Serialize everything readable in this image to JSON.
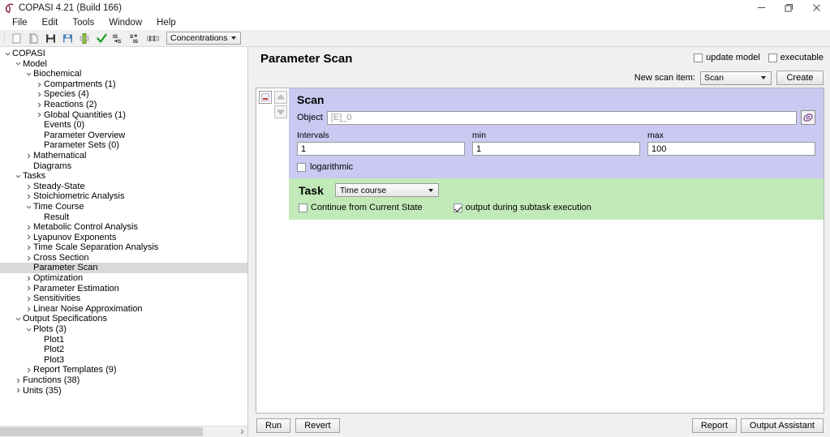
{
  "window": {
    "title": "COPASI 4.21 (Build 166)",
    "logo_icon": "copasi-logo-icon",
    "controls": [
      {
        "name": "minimize-button",
        "icon": "minimize-icon"
      },
      {
        "name": "restore-button",
        "icon": "restore-icon"
      },
      {
        "name": "close-button",
        "icon": "close-icon"
      }
    ]
  },
  "menubar": {
    "items": [
      {
        "label": "File"
      },
      {
        "label": "Edit"
      },
      {
        "label": "Tools"
      },
      {
        "label": "Window"
      },
      {
        "label": "Help"
      }
    ]
  },
  "toolbar": {
    "buttons": [
      {
        "name": "new-button",
        "icon": "new-document-icon"
      },
      {
        "name": "open-button",
        "icon": "open-folder-icon"
      },
      {
        "name": "save-button",
        "icon": "floppy-disk-icon"
      },
      {
        "name": "save-as-button",
        "icon": "save-as-icon"
      },
      {
        "name": "import-sbml-button",
        "icon": "import-icon"
      },
      {
        "name": "check-model-button",
        "icon": "check-mark-icon"
      },
      {
        "name": "sbml-to-copasi-button",
        "icon": "sbml-to-s-icon"
      },
      {
        "name": "copasi-to-sbml-button",
        "icon": "s-to-sbml-icon"
      },
      {
        "name": "sliders-button",
        "icon": "slider-icon"
      }
    ],
    "units_combo": {
      "value": "Concentrations",
      "icon": "chevron-down-icon"
    }
  },
  "sidebar": {
    "tree": [
      {
        "label": "COPASI",
        "indent": 0,
        "twist": "expanded",
        "selected": false
      },
      {
        "label": "Model",
        "indent": 1,
        "twist": "expanded",
        "selected": false
      },
      {
        "label": "Biochemical",
        "indent": 2,
        "twist": "expanded",
        "selected": false
      },
      {
        "label": "Compartments (1)",
        "indent": 3,
        "twist": "collapsed",
        "selected": false
      },
      {
        "label": "Species (4)",
        "indent": 3,
        "twist": "collapsed",
        "selected": false
      },
      {
        "label": "Reactions (2)",
        "indent": 3,
        "twist": "collapsed",
        "selected": false
      },
      {
        "label": "Global Quantities (1)",
        "indent": 3,
        "twist": "collapsed",
        "selected": false
      },
      {
        "label": "Events (0)",
        "indent": 3,
        "twist": "none",
        "selected": false
      },
      {
        "label": "Parameter Overview",
        "indent": 3,
        "twist": "none",
        "selected": false
      },
      {
        "label": "Parameter Sets (0)",
        "indent": 3,
        "twist": "none",
        "selected": false
      },
      {
        "label": "Mathematical",
        "indent": 2,
        "twist": "collapsed",
        "selected": false
      },
      {
        "label": "Diagrams",
        "indent": 2,
        "twist": "none",
        "selected": false
      },
      {
        "label": "Tasks",
        "indent": 1,
        "twist": "expanded",
        "selected": false
      },
      {
        "label": "Steady-State",
        "indent": 2,
        "twist": "collapsed",
        "selected": false
      },
      {
        "label": "Stoichiometric Analysis",
        "indent": 2,
        "twist": "collapsed",
        "selected": false
      },
      {
        "label": "Time Course",
        "indent": 2,
        "twist": "expanded",
        "selected": false
      },
      {
        "label": "Result",
        "indent": 3,
        "twist": "none",
        "selected": false
      },
      {
        "label": "Metabolic Control Analysis",
        "indent": 2,
        "twist": "collapsed",
        "selected": false
      },
      {
        "label": "Lyapunov Exponents",
        "indent": 2,
        "twist": "collapsed",
        "selected": false
      },
      {
        "label": "Time Scale Separation Analysis",
        "indent": 2,
        "twist": "collapsed",
        "selected": false
      },
      {
        "label": "Cross Section",
        "indent": 2,
        "twist": "collapsed",
        "selected": false
      },
      {
        "label": "Parameter Scan",
        "indent": 2,
        "twist": "none",
        "selected": true
      },
      {
        "label": "Optimization",
        "indent": 2,
        "twist": "collapsed",
        "selected": false
      },
      {
        "label": "Parameter Estimation",
        "indent": 2,
        "twist": "collapsed",
        "selected": false
      },
      {
        "label": "Sensitivities",
        "indent": 2,
        "twist": "collapsed",
        "selected": false
      },
      {
        "label": "Linear Noise Approximation",
        "indent": 2,
        "twist": "collapsed",
        "selected": false
      },
      {
        "label": "Output Specifications",
        "indent": 1,
        "twist": "expanded",
        "selected": false
      },
      {
        "label": "Plots (3)",
        "indent": 2,
        "twist": "expanded",
        "selected": false
      },
      {
        "label": "Plot1",
        "indent": 3,
        "twist": "none",
        "selected": false
      },
      {
        "label": "Plot2",
        "indent": 3,
        "twist": "none",
        "selected": false
      },
      {
        "label": "Plot3",
        "indent": 3,
        "twist": "none",
        "selected": false
      },
      {
        "label": "Report Templates (9)",
        "indent": 2,
        "twist": "collapsed",
        "selected": false
      },
      {
        "label": "Functions (38)",
        "indent": 1,
        "twist": "collapsed",
        "selected": false
      },
      {
        "label": "Units (35)",
        "indent": 1,
        "twist": "collapsed",
        "selected": false
      }
    ]
  },
  "main": {
    "title": "Parameter Scan",
    "update_model": {
      "label": "update model",
      "checked": false
    },
    "executable": {
      "label": "executable",
      "checked": false
    },
    "new_scan_item_label": "New scan item:",
    "new_scan_item_value": "Scan",
    "create_button": "Create",
    "scan": {
      "item_controls": [
        {
          "name": "delete-scan-item-button",
          "icon": "delete-minus-icon"
        },
        {
          "name": "move-up-button",
          "icon": "arrow-up-icon"
        },
        {
          "name": "move-down-button",
          "icon": "arrow-down-icon"
        }
      ],
      "section_title": "Scan",
      "object_label": "Object",
      "object_value": "[E]_0",
      "object_browse_icon": "copasi-object-browser-icon",
      "intervals_label": "Intervals",
      "intervals_value": "1",
      "min_label": "min",
      "min_value": "1",
      "max_label": "max",
      "max_value": "100",
      "logarithmic": {
        "label": "logarithmic",
        "checked": false
      }
    },
    "task": {
      "section_title": "Task",
      "task_value": "Time course",
      "continue_from_current_state": {
        "label": "Continue from Current State",
        "checked": false
      },
      "output_during_subtask": {
        "label": "output during subtask execution",
        "checked": true
      }
    }
  },
  "footer": {
    "run_button": "Run",
    "revert_button": "Revert",
    "report_button": "Report",
    "output_assistant_button": "Output Assistant"
  },
  "colors": {
    "scan_panel": "#c9c9f2",
    "task_panel": "#c2eab8",
    "selection": "#d9d9d9",
    "window_bg": "#f0f0f0"
  }
}
